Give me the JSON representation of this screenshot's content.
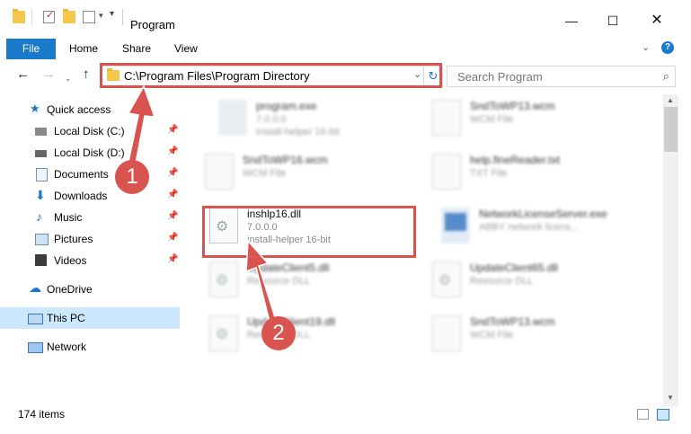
{
  "window": {
    "title": "Program"
  },
  "ribbon": {
    "tabs": [
      "File",
      "Home",
      "Share",
      "View"
    ]
  },
  "address": {
    "path": "C:\\Program Files\\Program Directory",
    "search_placeholder": "Search Program"
  },
  "nav": {
    "items": [
      {
        "label": "Quick access"
      },
      {
        "label": "Local Disk (C:)"
      },
      {
        "label": "Local Disk (D:)"
      },
      {
        "label": "Documents"
      },
      {
        "label": "Downloads"
      },
      {
        "label": "Music"
      },
      {
        "label": "Pictures"
      },
      {
        "label": "Videos"
      },
      {
        "label": "OneDrive"
      },
      {
        "label": "This PC"
      },
      {
        "label": "Network"
      }
    ]
  },
  "files": [
    {
      "name": "program.exe",
      "line2": "7.0.0.0",
      "line3": "install-helper 16-bit"
    },
    {
      "name": "SndToWP13.wcm",
      "line2": "WCM File",
      "line3": ""
    },
    {
      "name": "SndToWP16.wcm",
      "line2": "WCM File",
      "line3": ""
    },
    {
      "name": "help.fineReader.txt",
      "line2": "TXT File",
      "line3": ""
    },
    {
      "name": "inshlp16.dll",
      "line2": "7.0.0.0",
      "line3": "install-helper 16-bit"
    },
    {
      "name": "NetworkLicenseServer.exe",
      "line2": "ABBY network licens...",
      "line3": ""
    },
    {
      "name": "UpdateClient5.dll",
      "line2": "Resource DLL",
      "line3": ""
    },
    {
      "name": "UpdateClient65.dll",
      "line2": "Resource DLL",
      "line3": ""
    },
    {
      "name": "UpdateClient19.dll",
      "line2": "Resource DLL",
      "line3": ""
    },
    {
      "name": "SndToWP13.wcm",
      "line2": "WCM File",
      "line3": ""
    }
  ],
  "status": {
    "item_count": "174 items"
  },
  "annotations": {
    "step1": "1",
    "step2": "2",
    "color": "#d9534f"
  },
  "colors": {
    "accent": "#1979ca",
    "selection": "#cce8ff"
  }
}
